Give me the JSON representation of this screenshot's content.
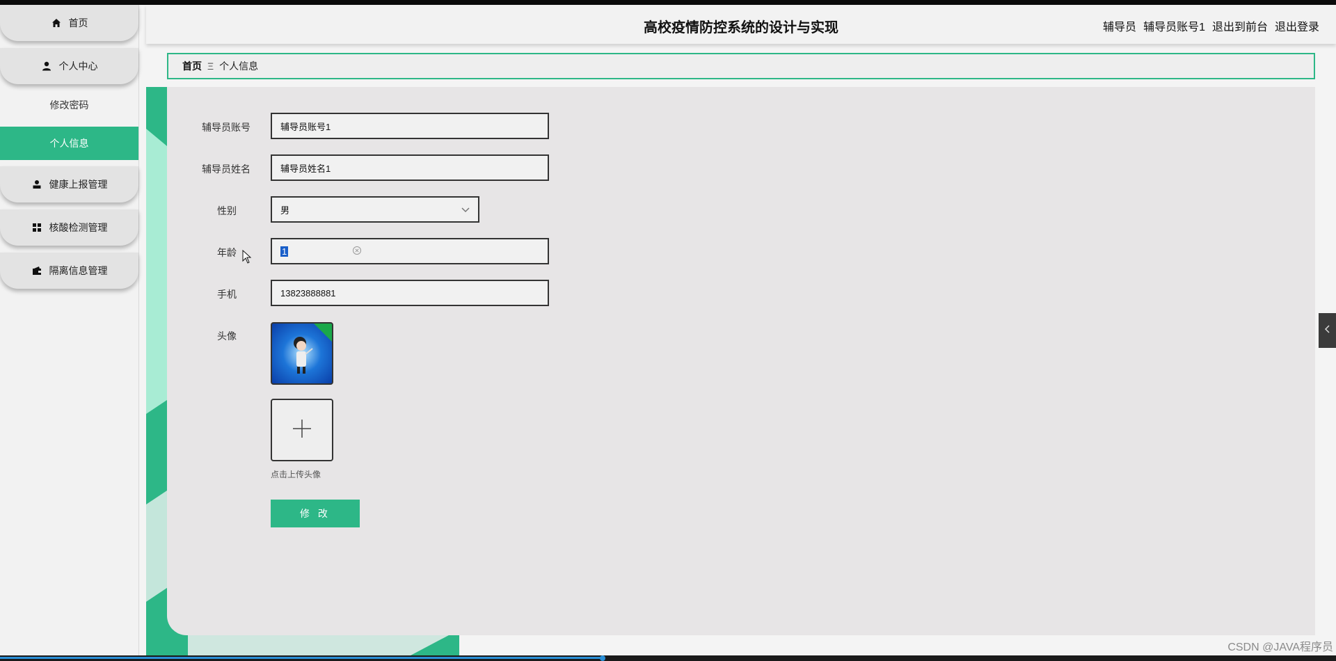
{
  "app": {
    "title": "高校疫情防控系统的设计与实现"
  },
  "header": {
    "role": "辅导员",
    "username": "辅导员账号1",
    "to_front": "退出到前台",
    "logout": "退出登录"
  },
  "sidebar": {
    "home": "首页",
    "personal_center": "个人中心",
    "change_password": "修改密码",
    "personal_info": "个人信息",
    "health_report": "健康上报管理",
    "nucleic_test": "核酸检测管理",
    "quarantine": "隔离信息管理"
  },
  "breadcrumb": {
    "home": "首页",
    "separator": "Ξ",
    "current": "个人信息"
  },
  "form": {
    "account_label": "辅导员账号",
    "account_value": "辅导员账号1",
    "name_label": "辅导员姓名",
    "name_value": "辅导员姓名1",
    "gender_label": "性别",
    "gender_value": "男",
    "age_label": "年龄",
    "age_value": "1",
    "phone_label": "手机",
    "phone_value": "13823888881",
    "avatar_label": "头像",
    "upload_hint": "点击上传头像",
    "submit_label": "修 改"
  },
  "watermark": "CSDN @JAVA程序员",
  "colors": {
    "accent": "#2db787",
    "panel": "#e7e5e6",
    "sidebar": "#f2f2f2"
  }
}
